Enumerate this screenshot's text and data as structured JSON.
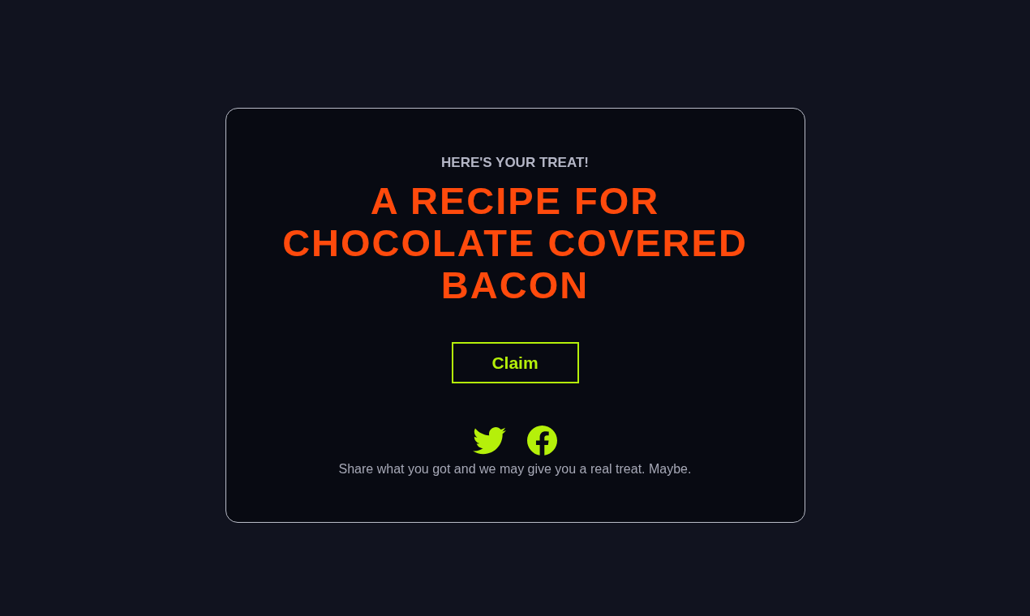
{
  "card": {
    "eyebrow": "HERE'S YOUR TREAT!",
    "title": "A RECIPE FOR CHOCOLATE COVERED BACON",
    "button": {
      "label": "Claim"
    },
    "share_caption": "Share what you got and we may give you a real treat. Maybe."
  }
}
